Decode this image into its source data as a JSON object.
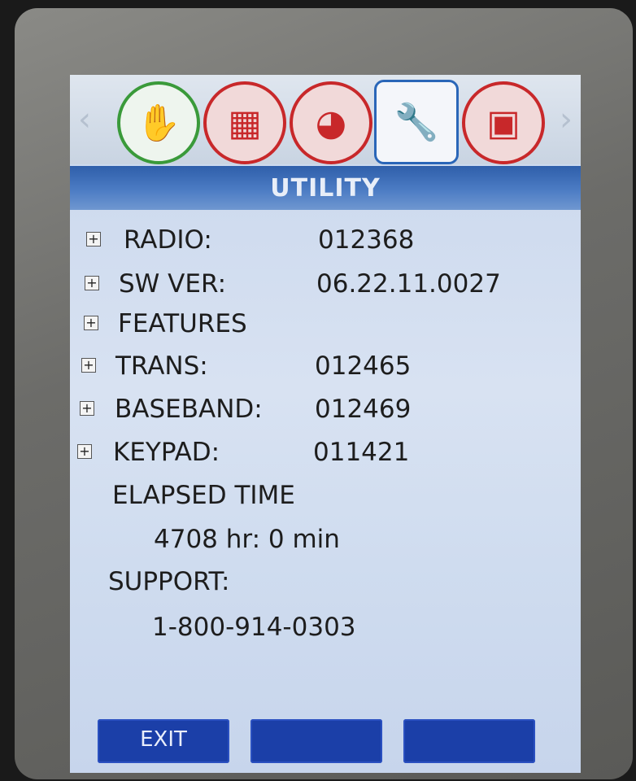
{
  "icons": [
    {
      "name": "hand-icon",
      "glyph": "✋"
    },
    {
      "name": "keypad-icon",
      "glyph": "▦"
    },
    {
      "name": "globe-icon",
      "glyph": "◕"
    },
    {
      "name": "wrench-icon",
      "glyph": "🔧"
    },
    {
      "name": "cube-icon",
      "glyph": "▣"
    }
  ],
  "nav": {
    "left": "‹",
    "right": "›"
  },
  "title": "UTILITY",
  "rows": [
    {
      "label": "RADIO:",
      "value": "012368"
    },
    {
      "label": "SW VER:",
      "value": "06.22.11.0027"
    },
    {
      "label": "FEATURES",
      "value": ""
    },
    {
      "label": "TRANS:",
      "value": "012465"
    },
    {
      "label": "BASEBAND:",
      "value": "012469"
    },
    {
      "label": "KEYPAD:",
      "value": "011421"
    }
  ],
  "plus": "+",
  "elapsed": {
    "label": "ELAPSED TIME",
    "value": "4708 hr: 0 min"
  },
  "support": {
    "label": "SUPPORT:",
    "value": "1-800-914-0303"
  },
  "softkeys": {
    "left": "EXIT",
    "middle": "",
    "right": ""
  }
}
